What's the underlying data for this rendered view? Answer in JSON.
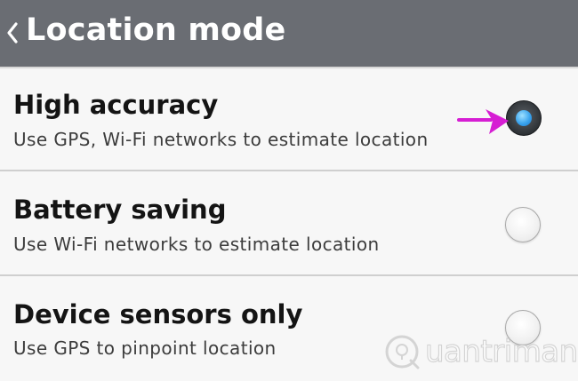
{
  "header": {
    "title": "Location mode",
    "back_icon": "chevron-left-icon",
    "background": "#6a6d73"
  },
  "options": [
    {
      "title": "High accuracy",
      "description": "Use GPS, Wi-Fi networks to estimate location",
      "selected": true
    },
    {
      "title": "Battery saving",
      "description": "Use Wi-Fi networks to estimate location",
      "selected": false
    },
    {
      "title": "Device sensors only",
      "description": "Use GPS to pinpoint location",
      "selected": false
    }
  ],
  "annotation": {
    "arrow_color": "#d61ed3",
    "arrow_icon": "arrow-right-icon"
  },
  "watermark": {
    "text": "uantrimang",
    "icon": "bulb-q-icon"
  },
  "colors": {
    "radio_selected_dot": "#3aa4ee",
    "divider": "#cfcfcf"
  }
}
